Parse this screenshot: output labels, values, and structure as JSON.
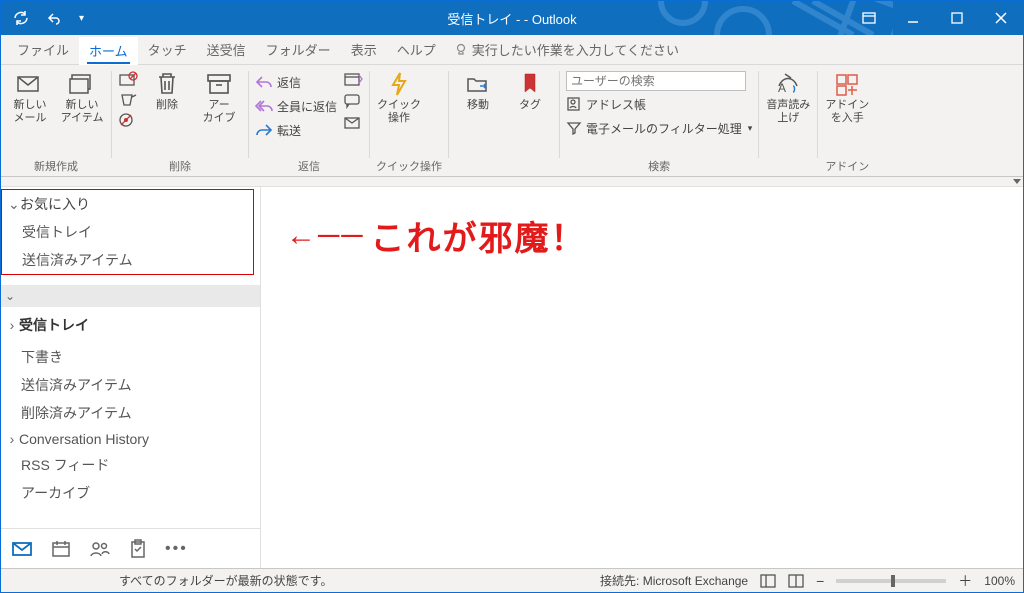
{
  "title": "受信トレイ -                               - Outlook",
  "ribbon_tabs": {
    "file": "ファイル",
    "home": "ホーム",
    "touch": "タッチ",
    "sendreceive": "送受信",
    "folder": "フォルダー",
    "view": "表示",
    "help": "ヘルプ",
    "tellme": "実行したい作業を入力してください"
  },
  "groups": {
    "newmail": "新しい\nメール",
    "newitem": "新しい\nアイテム",
    "g_new": "新規作成",
    "delete": "削除",
    "archive": "アー\nカイブ",
    "g_delete": "削除",
    "reply": "返信",
    "replyall": "全員に返信",
    "forward": "転送",
    "g_respond": "返信",
    "quick": "クイック\n操作",
    "g_quick": "クイック操作",
    "move": "移動",
    "tag": "タグ",
    "search_ph": "ユーザーの検索",
    "addrbook": "アドレス帳",
    "filter": "電子メールのフィルター処理",
    "g_find": "検索",
    "speech": "音声読み\n上げ",
    "addin": "アドイン\nを入手",
    "g_addin": "アドイン"
  },
  "sidebar": {
    "fav": "お気に入り",
    "fav_inbox": "受信トレイ",
    "fav_sent": "送信済みアイテム",
    "inbox": "受信トレイ",
    "drafts": "下書き",
    "sent": "送信済みアイテム",
    "deleted": "削除済みアイテム",
    "convhist": "Conversation History",
    "rss": "RSS フィード",
    "archive": "アーカイブ"
  },
  "annotation": "これが邪魔！",
  "status": {
    "left": "すべてのフォルダーが最新の状態です。",
    "conn": "接続先: Microsoft Exchange",
    "zoom": "100%"
  }
}
